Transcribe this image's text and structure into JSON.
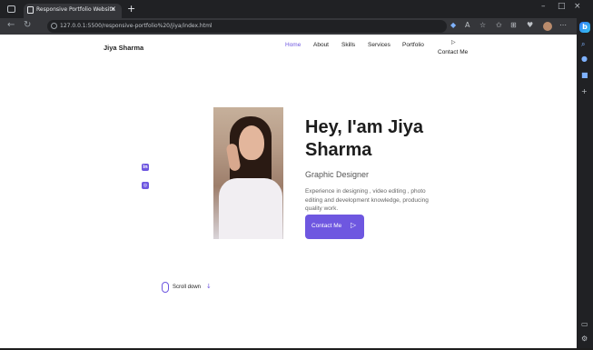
{
  "browser": {
    "tab_title": "Responsive Portfolio Website",
    "tab_close": "×",
    "new_tab": "+",
    "url": "127.0.0.1:5500/responsive-portfolio%20/jiya/index.html",
    "window_controls": [
      "–",
      "□",
      "×"
    ]
  },
  "page": {
    "logo": "Jiya Sharma",
    "nav": {
      "items": [
        "Home",
        "About",
        "Skills",
        "Services",
        "Portfolio"
      ],
      "contact_icon": "▷",
      "contact": "Contact Me"
    },
    "social": [
      "in",
      "◎"
    ],
    "hero": {
      "title": "Hey, I'am Jiya Sharma",
      "subtitle": "Graphic Designer",
      "description": "Experience in designing , video editing , photo editing and development knowledge, producing quality work.",
      "button_label": "Contact Me",
      "button_icon": "▷"
    },
    "scroll": {
      "label": "Scroll down",
      "arrow": "↓"
    }
  },
  "colors": {
    "accent": "#6e57e0",
    "chrome_dark": "#202124",
    "chrome_tab": "#35363a"
  }
}
